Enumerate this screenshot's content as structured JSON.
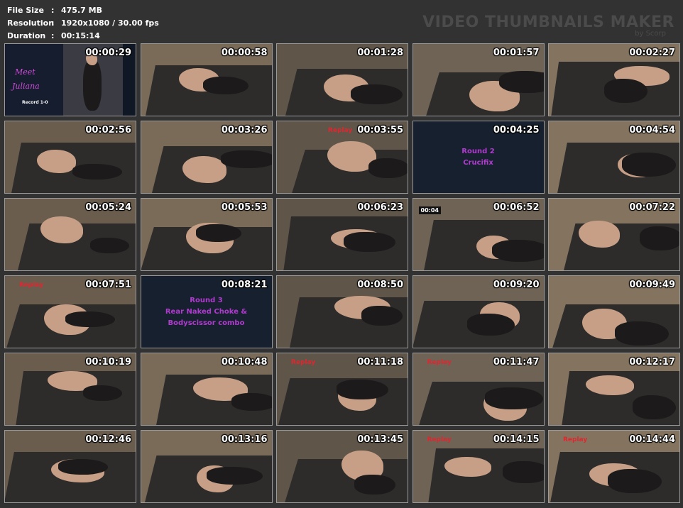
{
  "info": {
    "file_size": {
      "label": "File Size",
      "value": "475.7 MB"
    },
    "resolution": {
      "label": "Resolution",
      "value": "1920x1080 / 30.00 fps"
    },
    "duration": {
      "label": "Duration",
      "value": "00:15:14"
    }
  },
  "brand": {
    "title": "VIDEO THUMBNAILS MAKER",
    "sub": "by Scorp"
  },
  "thumbs": [
    {
      "ts": "00:00:29",
      "card": "meet",
      "lines": [
        "Meet",
        "Juliana"
      ],
      "sub": "Record 1-0"
    },
    {
      "ts": "00:00:58"
    },
    {
      "ts": "00:01:28"
    },
    {
      "ts": "00:01:57"
    },
    {
      "ts": "00:02:27"
    },
    {
      "ts": "00:02:56"
    },
    {
      "ts": "00:03:26"
    },
    {
      "ts": "00:03:55",
      "replay": "Replay"
    },
    {
      "ts": "00:04:25",
      "card": "round",
      "lines": [
        "Round 2",
        "Crucifix"
      ]
    },
    {
      "ts": "00:04:54"
    },
    {
      "ts": "00:05:24"
    },
    {
      "ts": "00:05:53"
    },
    {
      "ts": "00:06:23"
    },
    {
      "ts": "00:06:52",
      "clock": "00:04"
    },
    {
      "ts": "00:07:22"
    },
    {
      "ts": "00:07:51",
      "replay": "Replay"
    },
    {
      "ts": "00:08:21",
      "card": "round",
      "lines": [
        "Round 3",
        "Rear Naked Choke &",
        "Bodyscissor combo"
      ]
    },
    {
      "ts": "00:08:50"
    },
    {
      "ts": "00:09:20"
    },
    {
      "ts": "00:09:49"
    },
    {
      "ts": "00:10:19"
    },
    {
      "ts": "00:10:48"
    },
    {
      "ts": "00:11:18",
      "replay": "Replay"
    },
    {
      "ts": "00:11:47",
      "replay": "Replay"
    },
    {
      "ts": "00:12:17"
    },
    {
      "ts": "00:12:46"
    },
    {
      "ts": "00:13:16"
    },
    {
      "ts": "00:13:45"
    },
    {
      "ts": "00:14:15",
      "replay": "Replay"
    },
    {
      "ts": "00:14:44",
      "replay": "Replay"
    }
  ]
}
